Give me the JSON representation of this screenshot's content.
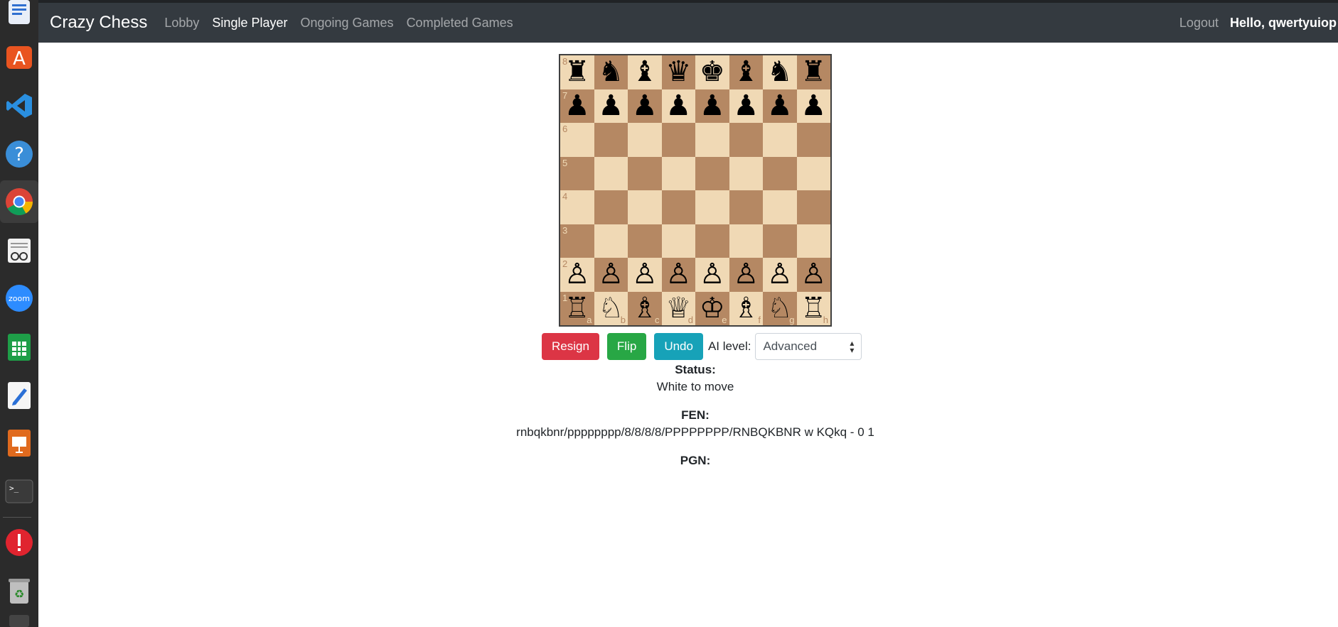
{
  "navbar": {
    "brand": "Crazy Chess",
    "links": [
      "Lobby",
      "Single Player",
      "Ongoing Games",
      "Completed Games"
    ],
    "logout": "Logout",
    "greeting": "Hello, qwertyuiop"
  },
  "board": {
    "ranks": [
      "8",
      "7",
      "6",
      "5",
      "4",
      "3",
      "2",
      "1"
    ],
    "files": [
      "a",
      "b",
      "c",
      "d",
      "e",
      "f",
      "g",
      "h"
    ],
    "rows": [
      [
        "♜",
        "♞",
        "♝",
        "♛",
        "♚",
        "♝",
        "♞",
        "♜"
      ],
      [
        "♟",
        "♟",
        "♟",
        "♟",
        "♟",
        "♟",
        "♟",
        "♟"
      ],
      [
        "",
        "",
        "",
        "",
        "",
        "",
        "",
        ""
      ],
      [
        "",
        "",
        "",
        "",
        "",
        "",
        "",
        ""
      ],
      [
        "",
        "",
        "",
        "",
        "",
        "",
        "",
        ""
      ],
      [
        "",
        "",
        "",
        "",
        "",
        "",
        "",
        ""
      ],
      [
        "♙",
        "♙",
        "♙",
        "♙",
        "♙",
        "♙",
        "♙",
        "♙"
      ],
      [
        "♖",
        "♘",
        "♗",
        "♕",
        "♔",
        "♗",
        "♘",
        "♖"
      ]
    ],
    "light_color": "#f0d9b5",
    "dark_color": "#b58863"
  },
  "controls": {
    "resign": "Resign",
    "flip": "Flip",
    "undo": "Undo",
    "ai_label": "AI level:",
    "ai_value": "Advanced"
  },
  "status": {
    "label": "Status:",
    "value": "White to move"
  },
  "fen": {
    "label": "FEN:",
    "value": "rnbqkbnr/pppppppp/8/8/8/8/PPPPPPPP/RNBQKBNR w KQkq - 0 1"
  },
  "pgn": {
    "label": "PGN:",
    "value": ""
  }
}
